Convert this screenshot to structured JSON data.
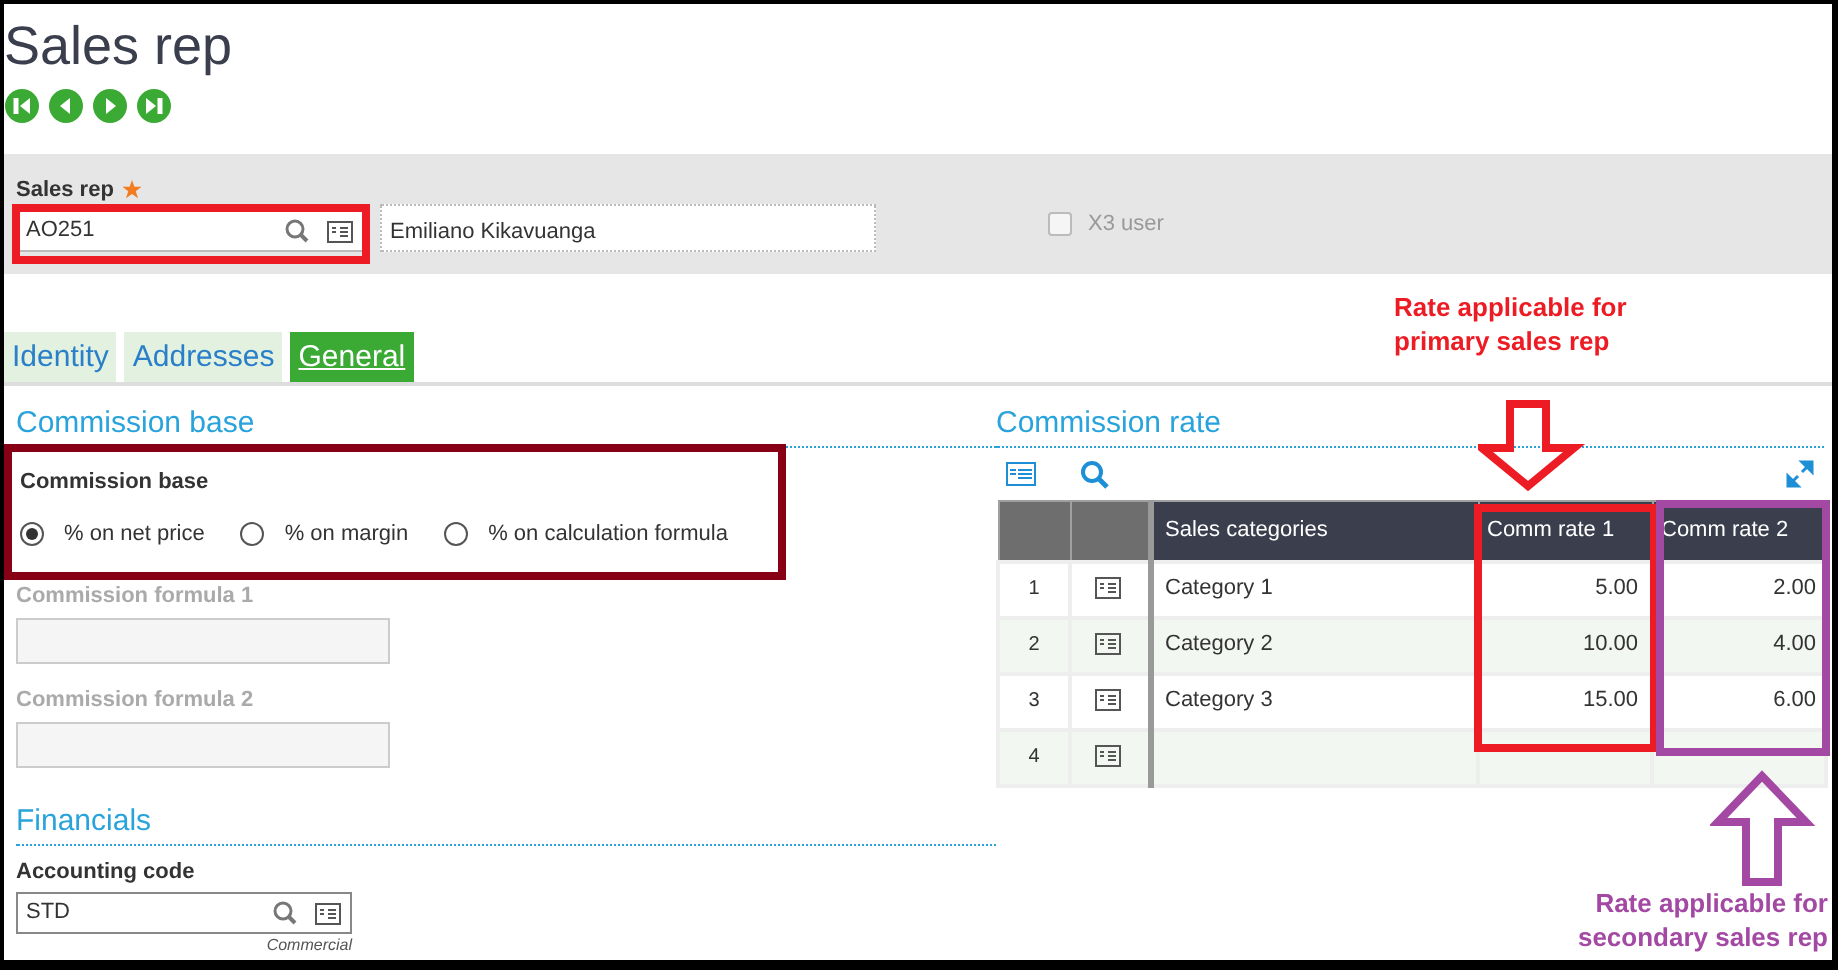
{
  "page_title": "Sales rep",
  "nav_buttons": [
    {
      "kind": "first"
    },
    {
      "kind": "previous"
    },
    {
      "kind": "next"
    },
    {
      "kind": "last"
    }
  ],
  "header": {
    "sales_rep": {
      "label": "Sales rep",
      "required": true,
      "value": "AO251"
    },
    "name_value": "Emiliano Kikavuanga",
    "x3_user": {
      "label": "X3 user",
      "checked": false
    }
  },
  "tabs": [
    {
      "label": "Identity",
      "selected": false
    },
    {
      "label": "Addresses",
      "selected": false
    },
    {
      "label": "General",
      "selected": true
    }
  ],
  "commission_base": {
    "heading": "Commission base",
    "label": "Commission base",
    "options": [
      {
        "label": "% on net price",
        "selected": true
      },
      {
        "label": "% on margin",
        "selected": false
      },
      {
        "label": "% on calculation formula",
        "selected": false
      }
    ],
    "formulas": [
      {
        "label": "Commission formula 1",
        "disabled": true
      },
      {
        "label": "Commission formula 2",
        "disabled": true
      }
    ]
  },
  "financials": {
    "heading": "Financials",
    "accounting_code": {
      "label": "Accounting code",
      "value": "STD",
      "caption": "Commercial"
    }
  },
  "commission_rate": {
    "heading": "Commission rate",
    "table": {
      "columns": [
        "Sales categories",
        "Comm rate 1",
        "Comm rate 2"
      ],
      "rows": [
        {
          "number": "1",
          "category": "Category 1",
          "rate_1": "5.00",
          "rate_2": "2.00"
        },
        {
          "number": "2",
          "category": "Category 2",
          "rate_1": "10.00",
          "rate_2": "4.00"
        },
        {
          "number": "3",
          "category": "Category 3",
          "rate_1": "15.00",
          "rate_2": "6.00"
        },
        {
          "number": "4"
        }
      ]
    }
  },
  "annotations": [
    {
      "kind": "box",
      "color": "#ed1c24"
    },
    {
      "kind": "box",
      "color": "#880015"
    },
    {
      "kind": "note",
      "color": "#ed1c24",
      "text": "Rate applicable for\nprimary sales rep"
    },
    {
      "kind": "arrow_down",
      "color": "#ed1c24"
    },
    {
      "kind": "box",
      "color": "#ed1c24"
    },
    {
      "kind": "box",
      "color": "#a349a4"
    },
    {
      "kind": "arrow_up",
      "color": "#a349a4"
    },
    {
      "kind": "note",
      "color": "#a349a4",
      "text": "Rate applicable for\nsecondary sales rep"
    }
  ]
}
